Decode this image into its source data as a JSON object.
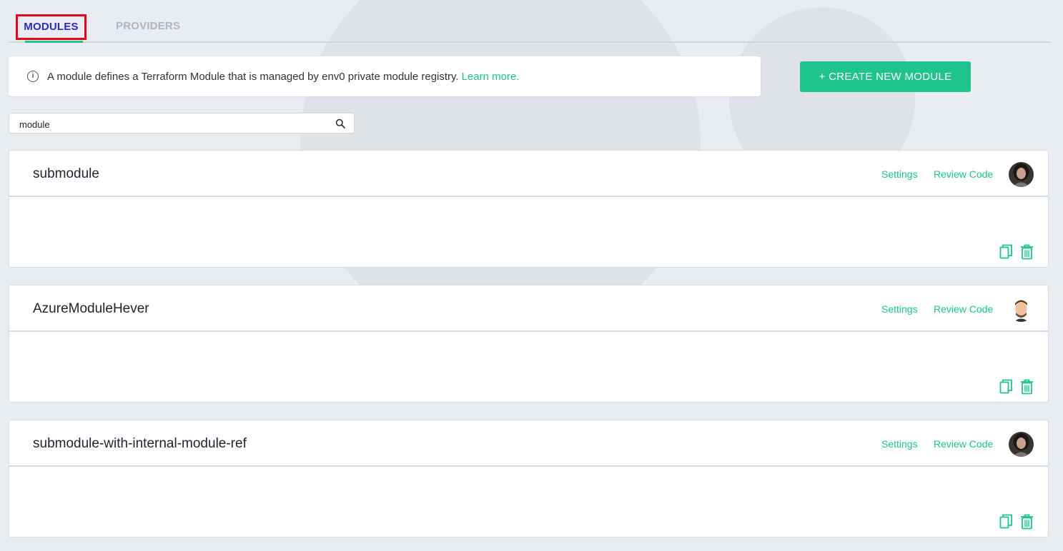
{
  "tabs": [
    {
      "label": "MODULES",
      "active": true
    },
    {
      "label": "PROVIDERS",
      "active": false
    }
  ],
  "info": {
    "text": "A module defines a Terraform Module that is managed by env0 private module registry.",
    "link": "Learn more."
  },
  "create_button": "+ CREATE NEW MODULE",
  "search": {
    "value": "module"
  },
  "modules": [
    {
      "name": "submodule",
      "settings": "Settings",
      "review": "Review Code",
      "avatar": "dark-hair-avatar"
    },
    {
      "name": "AzureModuleHever",
      "settings": "Settings",
      "review": "Review Code",
      "avatar": "memoji-avatar"
    },
    {
      "name": "submodule-with-internal-module-ref",
      "settings": "Settings",
      "review": "Review Code",
      "avatar": "dark-hair-avatar"
    }
  ],
  "colors": {
    "accent": "#1ec38d",
    "active_tab": "#2b2bb8",
    "highlight_box": "#e4061c"
  }
}
